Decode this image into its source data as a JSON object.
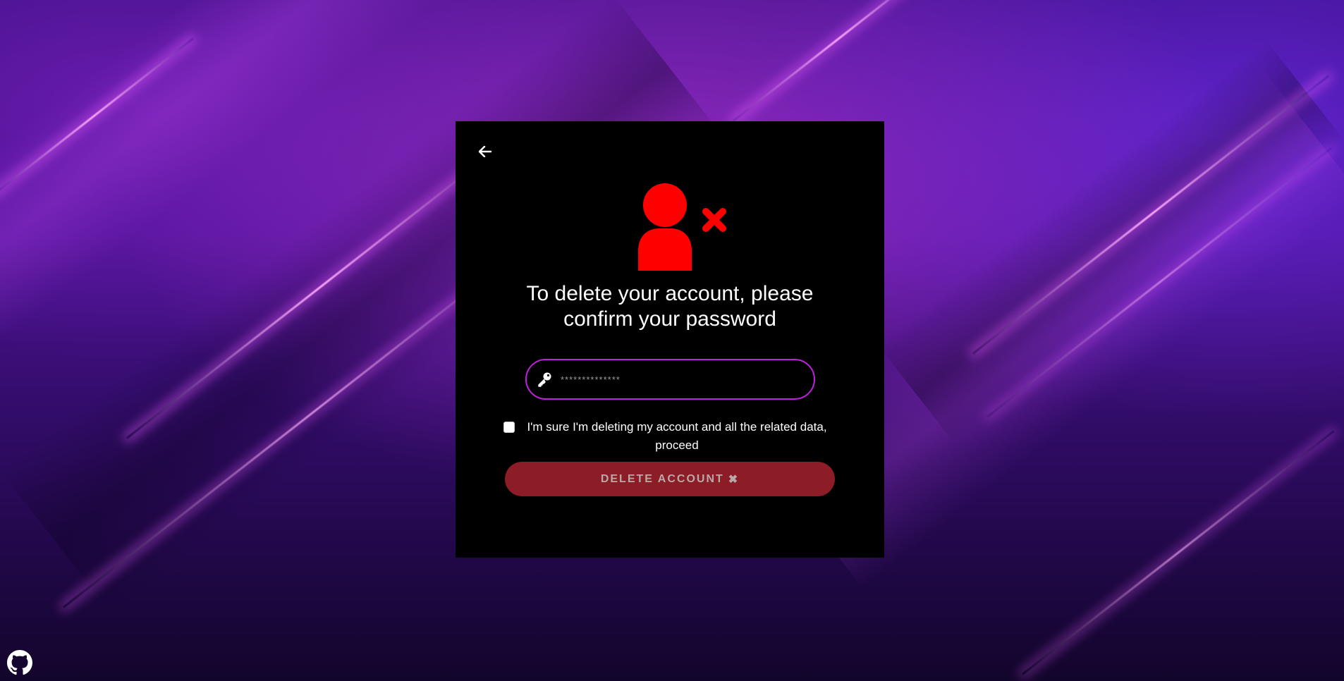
{
  "page": {
    "title_line": "To delete your account, please confirm your password"
  },
  "password_field": {
    "placeholder": "**************"
  },
  "confirm": {
    "label": "I'm sure I'm deleting my account and all the related data, proceed",
    "checked": false
  },
  "delete_button": {
    "label": "DELETE ACCOUNT",
    "icon": "✖"
  },
  "icons": {
    "back": "arrow-left-icon",
    "hero": "user-xmark-icon",
    "key": "key-icon",
    "github": "github-icon"
  },
  "colors": {
    "accent": "#c21fe0",
    "danger": "#ff0000",
    "button_bg": "#8c1c25",
    "card_bg": "#000000"
  }
}
